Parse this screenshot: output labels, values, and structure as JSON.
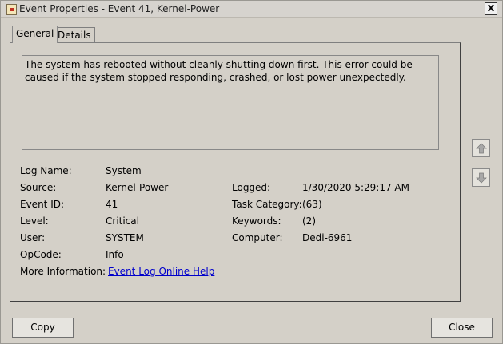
{
  "window": {
    "title": "Event Properties - Event 41, Kernel-Power",
    "close_glyph": "X"
  },
  "tabs": [
    {
      "label": "General"
    },
    {
      "label": "Details"
    }
  ],
  "description": "The system has rebooted without cleanly shutting down first. This error could be caused if the system stopped responding, crashed, or lost power unexpectedly.",
  "fields": {
    "log_name": {
      "label": "Log Name:",
      "value": "System"
    },
    "source": {
      "label": "Source:",
      "value": "Kernel-Power"
    },
    "event_id": {
      "label": "Event ID:",
      "value": "41"
    },
    "level": {
      "label": "Level:",
      "value": "Critical"
    },
    "user": {
      "label": "User:",
      "value": "SYSTEM"
    },
    "opcode": {
      "label": "OpCode:",
      "value": "Info"
    },
    "more_info": {
      "label": "More Information:",
      "value": "Event Log Online Help"
    },
    "logged": {
      "label": "Logged:",
      "value": "1/30/2020 5:29:17 AM"
    },
    "task_category": {
      "label": "Task Category:",
      "value": "(63)"
    },
    "keywords": {
      "label": "Keywords:",
      "value": "(2)"
    },
    "computer": {
      "label": "Computer:",
      "value": "Dedi-6961"
    }
  },
  "icons": {
    "up": "arrow-up-icon",
    "down": "arrow-down-icon",
    "app": "event-viewer-icon"
  },
  "buttons": {
    "copy": "Copy",
    "close": "Close"
  }
}
